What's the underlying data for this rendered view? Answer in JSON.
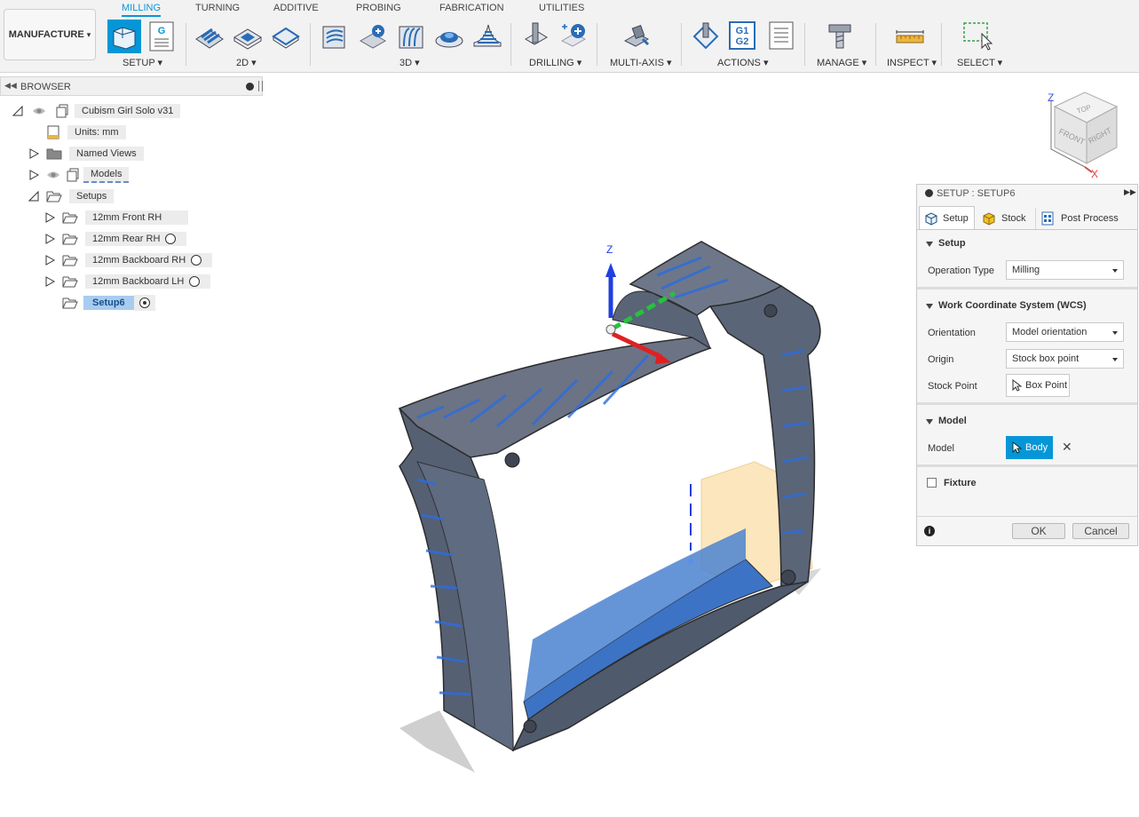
{
  "workspace": {
    "label": "MANUFACTURE",
    "arrow": "▾"
  },
  "tabs": [
    {
      "label": "MILLING",
      "active": true
    },
    {
      "label": "TURNING",
      "active": false
    },
    {
      "label": "ADDITIVE",
      "active": false
    },
    {
      "label": "PROBING",
      "active": false
    },
    {
      "label": "FABRICATION",
      "active": false
    },
    {
      "label": "UTILITIES",
      "active": false
    }
  ],
  "groups": {
    "setup": "SETUP ▾",
    "g2d": "2D ▾",
    "g3d": "3D ▾",
    "drilling": "DRILLING ▾",
    "multiaxis": "MULTI-AXIS ▾",
    "actions": "ACTIONS ▾",
    "manage": "MANAGE ▾",
    "inspect": "INSPECT ▾",
    "select": "SELECT ▾"
  },
  "gcode_icon": {
    "line1": "G1",
    "line2": "G2",
    "g": "G"
  },
  "browser": {
    "title": "BROWSER",
    "root": "Cubism Girl Solo v31",
    "units": "Units: mm",
    "named_views": "Named Views",
    "models": "Models",
    "setups": "Setups",
    "setup_items": [
      "12mm Front RH",
      "12mm Rear RH",
      "12mm Backboard RH",
      "12mm Backboard LH"
    ],
    "selected_setup": "Setup6"
  },
  "viewcube": {
    "top": "TOP",
    "front": "FRONT",
    "right": "RIGHT",
    "z": "Z",
    "x": "X"
  },
  "triad": {
    "z": "Z"
  },
  "panel": {
    "title": "SETUP : SETUP6",
    "tabs": [
      "Setup",
      "Stock",
      "Post Process"
    ],
    "sections": {
      "setup": "Setup",
      "wcs": "Work Coordinate System (WCS)",
      "model": "Model",
      "fixture": "Fixture"
    },
    "fields": {
      "operation_type_label": "Operation Type",
      "operation_type_value": "Milling",
      "orientation_label": "Orientation",
      "orientation_value": "Model orientation",
      "origin_label": "Origin",
      "origin_value": "Stock box point",
      "stock_point_label": "Stock Point",
      "stock_point_value": "Box Point",
      "model_label": "Model",
      "model_value": "Body"
    },
    "ok": "OK",
    "cancel": "Cancel"
  },
  "colors": {
    "accent": "#0696d7",
    "selection": "#a8ccf0",
    "model_blue": "#3d73c4",
    "stock_orange": "#f5c160"
  }
}
